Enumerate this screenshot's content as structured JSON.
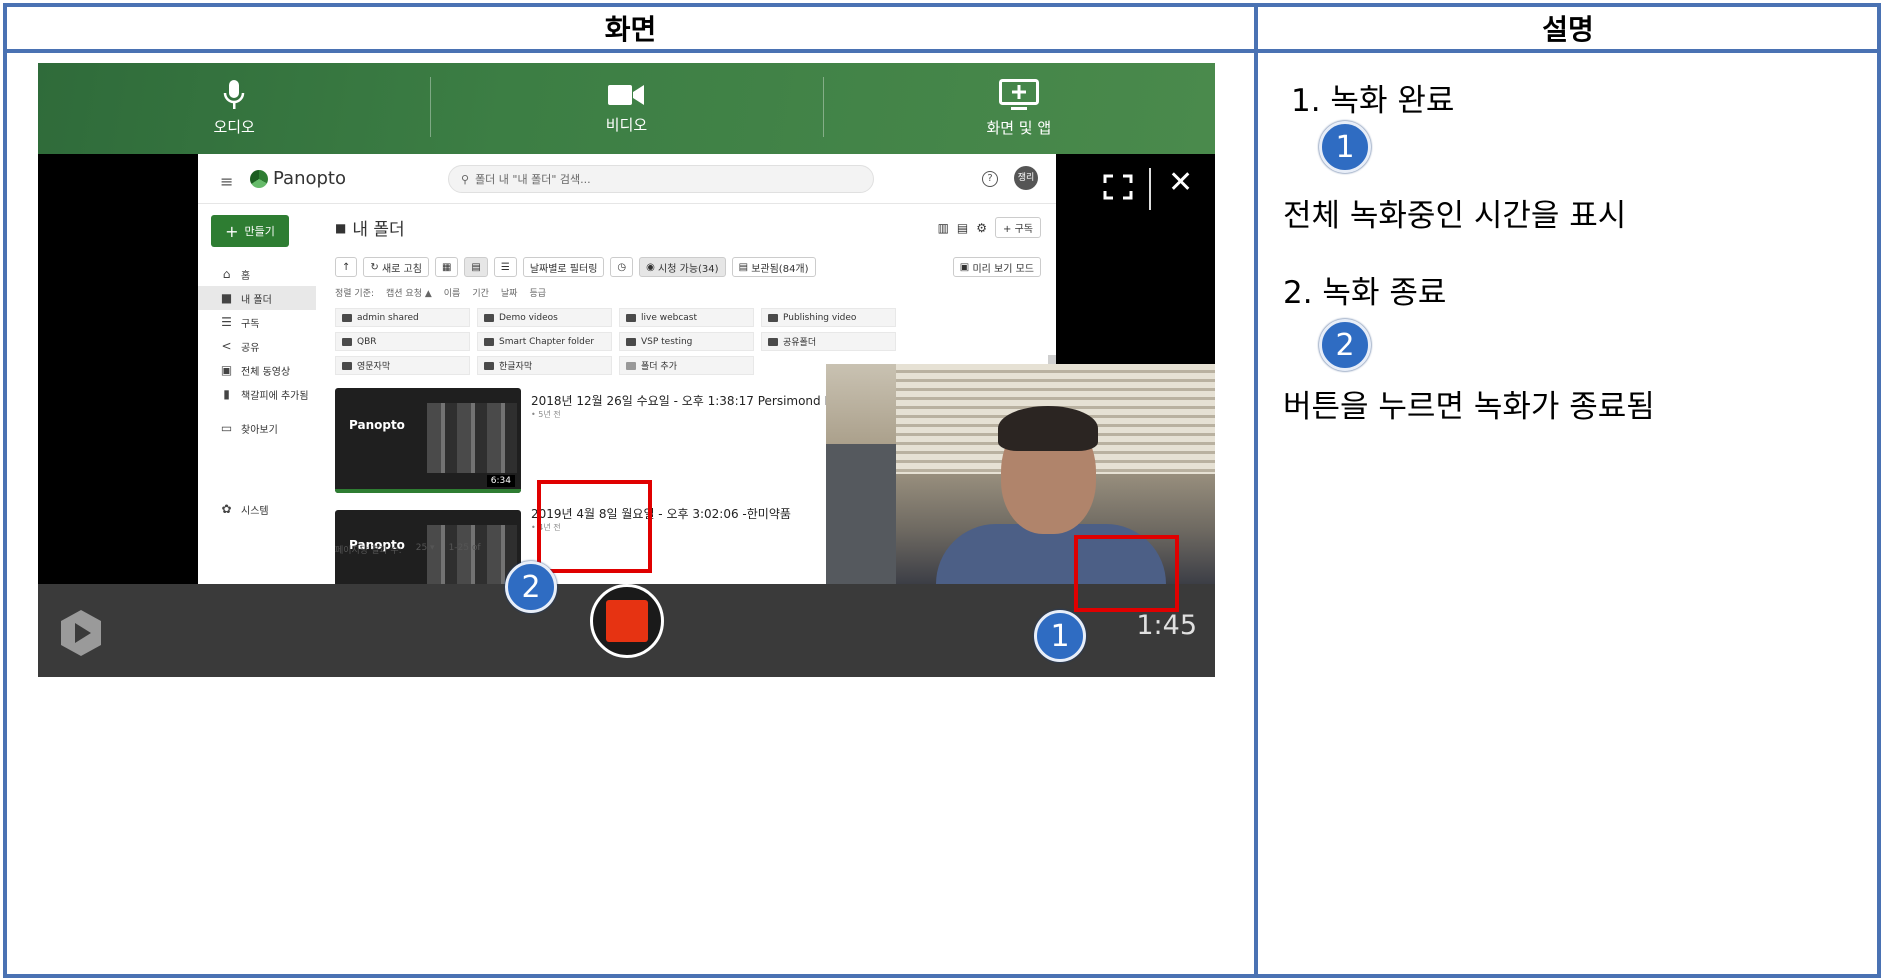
{
  "header": {
    "screen_label": "화면",
    "desc_label": "설명"
  },
  "recorder": {
    "sources": [
      {
        "label": "오디오",
        "icon": "microphone-icon"
      },
      {
        "label": "비디오",
        "icon": "video-camera-icon"
      },
      {
        "label": "화면 및 앱",
        "icon": "screen-add-icon"
      }
    ],
    "timer": "1:45",
    "accent": "#3c7e44",
    "stop_color": "#e63312"
  },
  "panopto": {
    "logo": "Panopto",
    "search_placeholder": "폴더 내 \"내 폴더\" 검색...",
    "avatar": "쟁리",
    "create_label": "만들기",
    "nav": [
      {
        "label": "홈",
        "icon": "home-icon"
      },
      {
        "label": "내 폴더",
        "icon": "folder-icon"
      },
      {
        "label": "구독",
        "icon": "subscriptions-icon"
      },
      {
        "label": "공유",
        "icon": "share-icon"
      },
      {
        "label": "전체 동영상",
        "icon": "video-library-icon"
      },
      {
        "label": "책갈피에 추가됨",
        "icon": "bookmark-icon"
      },
      {
        "label": "찾아보기",
        "icon": "browse-icon"
      },
      {
        "label": "시스템",
        "icon": "system-gear-icon"
      }
    ],
    "page_title": "내 폴더",
    "subscribe_label": "+ 구독",
    "toolbar": {
      "refresh": "새로 고침",
      "date_filter": "날짜별로 필터링",
      "viewable": "시청 가능(34)",
      "archived": "보관됨(84개)",
      "preview_mode": "미리 보기 모드"
    },
    "sort": {
      "label": "정렬 기준:",
      "options": [
        "캡션 요청 ▲",
        "이름",
        "기간",
        "날짜",
        "등급"
      ]
    },
    "folders": [
      "admin shared",
      "Demo videos",
      "live webcast",
      "Publishing video",
      "QBR",
      "Smart Chapter folder",
      "VSP testing",
      "공유폴더",
      "영문자막",
      "한글자막",
      "폴더 추가"
    ],
    "sessions": [
      {
        "title": "2018년 12월 26일 수요일 - 오후 1:38:17 Persimond La",
        "age": "• 5년 전",
        "duration": "6:34",
        "thumb_logo": "Panopto"
      },
      {
        "title": "2019년 4월 8일 월요일 - 오후 3:02:06 -한미약품",
        "age": "• 4년 전",
        "thumb_logo": "Panopto"
      }
    ],
    "pager": {
      "label": "페이지당 결과 수:",
      "value": "25 ▾",
      "range": "1-25 of"
    }
  },
  "markers": {
    "one": "1",
    "two": "2"
  },
  "description": {
    "item1_heading": "1. 녹화 완료",
    "item1_text": "전체 녹화중인 시간을 표시",
    "item2_heading": "2. 녹화 종료",
    "item2_text": "버튼을 누르면 녹화가 종료됨"
  }
}
